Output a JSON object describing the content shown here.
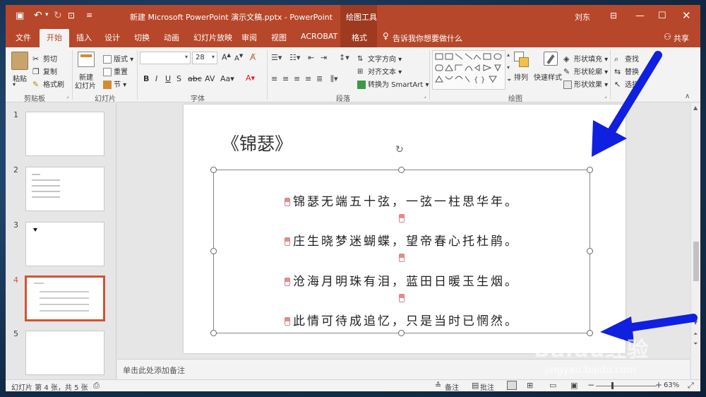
{
  "titlebar": {
    "document_title": "新建 Microsoft PowerPoint 演示文稿.pptx  -  PowerPoint",
    "context_tab": "绘图工具",
    "user": "刘东"
  },
  "tabs": [
    "文件",
    "开始",
    "插入",
    "设计",
    "切换",
    "动画",
    "幻灯片放映",
    "审阅",
    "视图",
    "ACROBAT",
    "格式"
  ],
  "tell_me": "告诉我你想要做什么",
  "share": "共享",
  "ribbon": {
    "clipboard": {
      "paste": "粘贴",
      "cut": "剪切",
      "copy": "复制",
      "format_painter": "格式刷",
      "label": "剪贴板"
    },
    "slides": {
      "new_slide_1": "新建",
      "new_slide_2": "幻灯片",
      "layout": "版式",
      "reset": "重置",
      "section": "节",
      "label": "幻灯片"
    },
    "font": {
      "size": "28",
      "label": "字体"
    },
    "paragraph": {
      "text_direction": "文字方向",
      "align_text": "对齐文本",
      "smartart": "转换为 SmartArt",
      "label": "段落"
    },
    "drawing": {
      "arrange": "排列",
      "quick_styles": "快速样式",
      "shape_fill": "形状填充",
      "shape_outline": "形状轮廓",
      "shape_effects": "形状效果",
      "label": "绘图"
    },
    "editing": {
      "find": "查找",
      "replace": "替换",
      "select": "选择"
    }
  },
  "thumbnails": [
    {
      "num": "1"
    },
    {
      "num": "2"
    },
    {
      "num": "3"
    },
    {
      "num": "4"
    },
    {
      "num": "5"
    }
  ],
  "slide": {
    "title": "《锦瑟》",
    "lines": [
      "锦瑟无端五十弦，一弦一柱思华年。",
      "庄生晓梦迷蝴蝶，望帝春心托杜鹃。",
      "沧海月明珠有泪，蓝田日暖玉生烟。",
      "此情可待成追忆，只是当时已惘然。"
    ]
  },
  "notes_placeholder": "单击此处添加备注",
  "status": {
    "slide_info": "幻灯片 第 4 张，共 5 张",
    "notes": "备注",
    "comments": "批注",
    "zoom": "63%"
  },
  "watermark": {
    "logo": "Baidu经验",
    "url": "jingyan.baidu.com"
  },
  "colors": {
    "accent": "#b7472a",
    "selected_thumb": "#d35230",
    "arrow": "#1020e0"
  }
}
